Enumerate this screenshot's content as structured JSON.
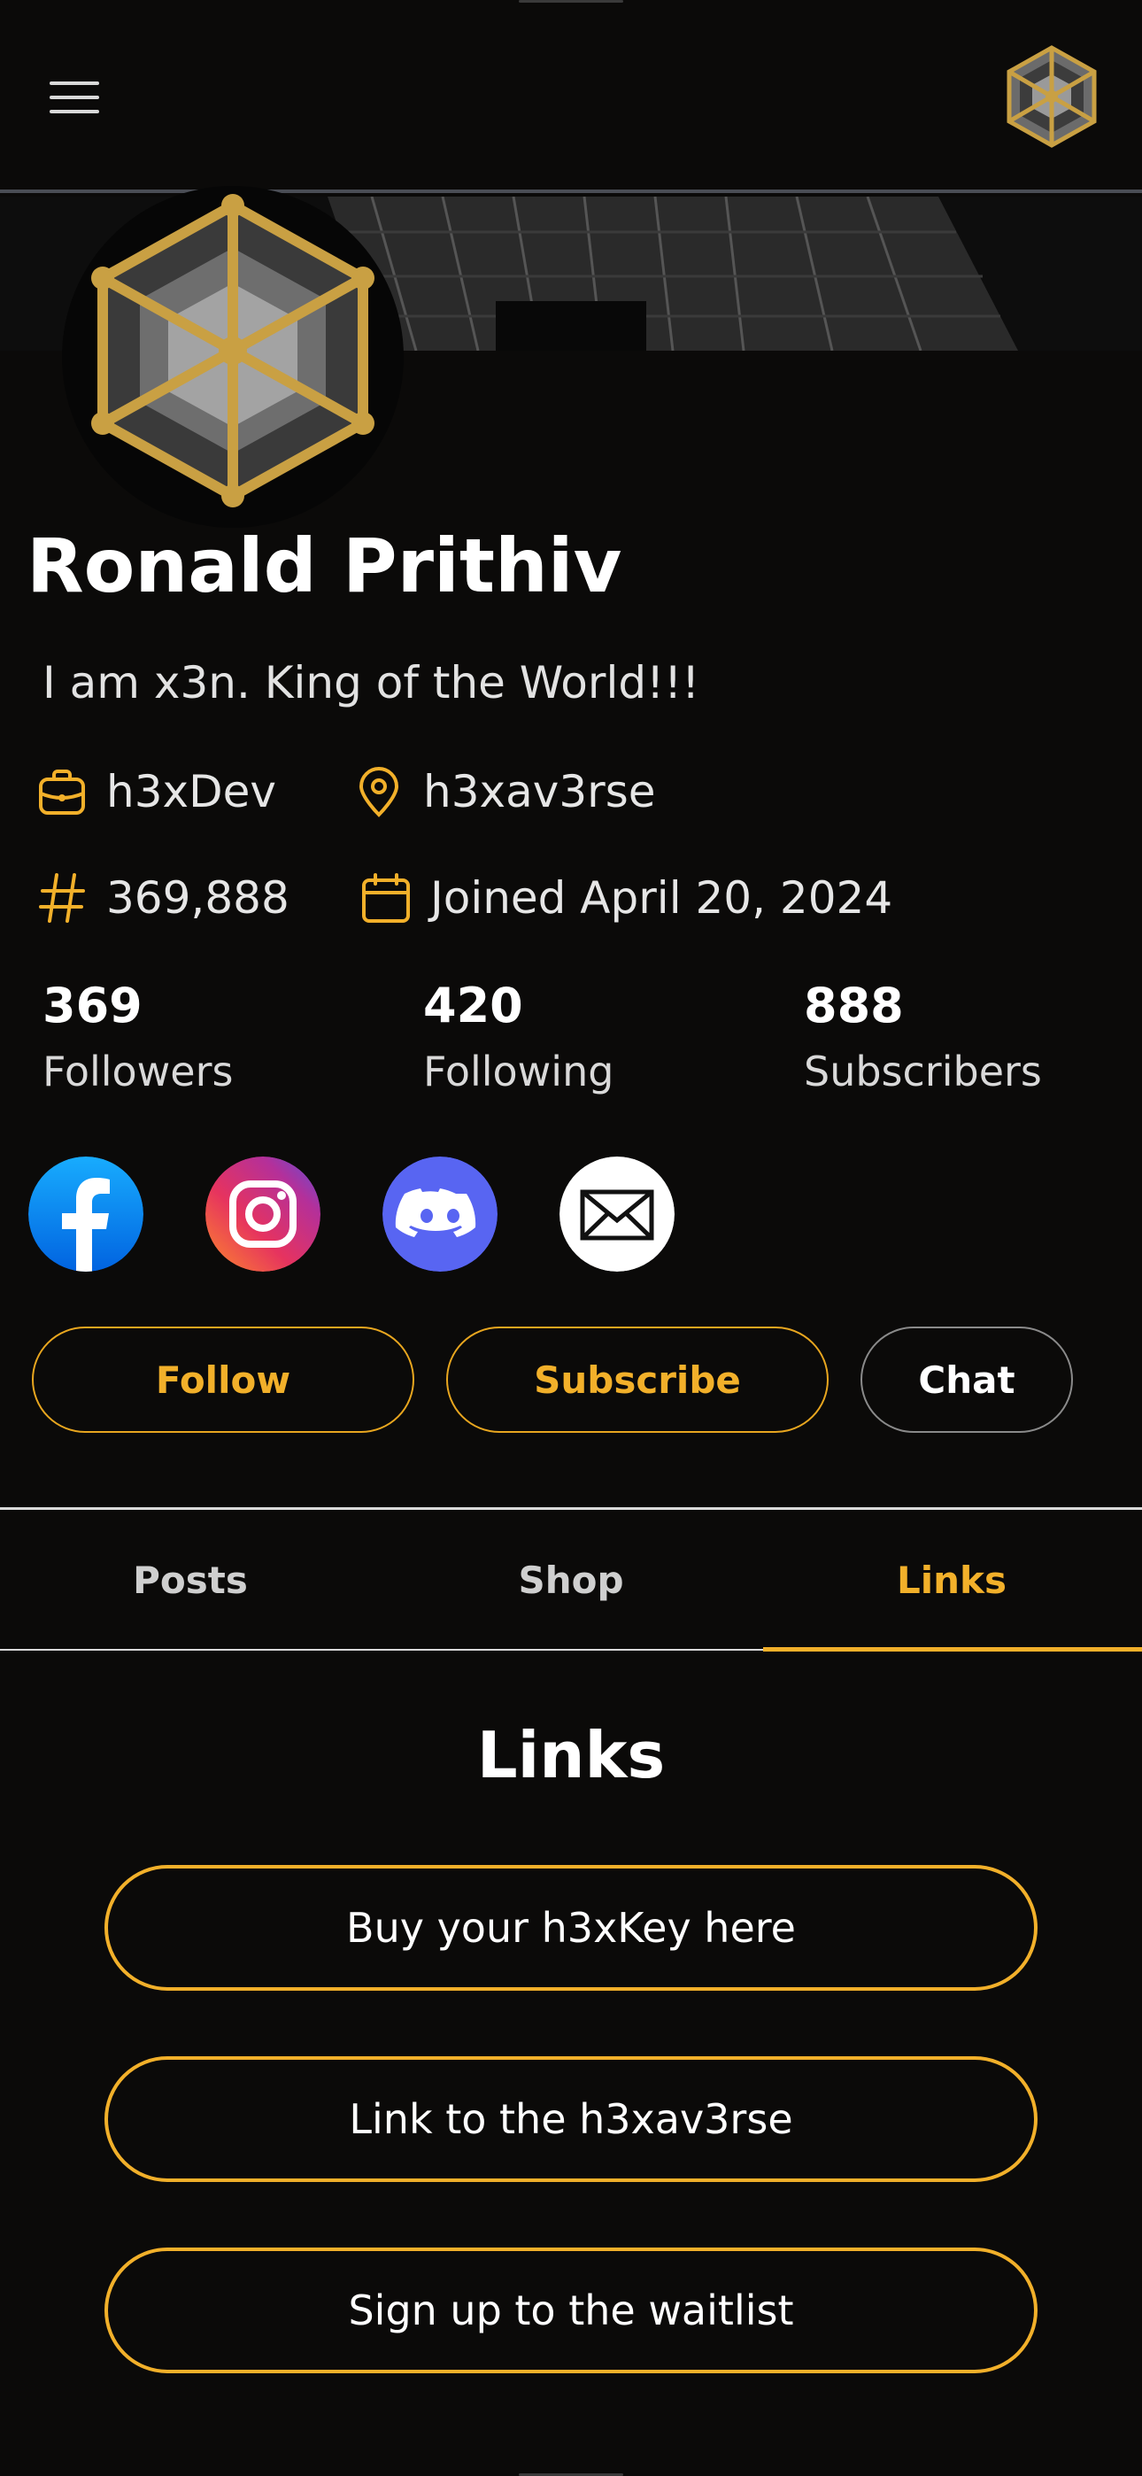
{
  "header": {
    "menu_icon": "hamburger-menu-icon",
    "logo_icon": "hexagon-cube-logo"
  },
  "profile": {
    "name": "Ronald Prithiv",
    "bio": "I am x3n. King of the World!!!",
    "work": "h3xDev",
    "location": "h3xav3rse",
    "tag": "369,888",
    "joined": "Joined April 20, 2024"
  },
  "stats": [
    {
      "value": "369",
      "label": "Followers"
    },
    {
      "value": "420",
      "label": "Following"
    },
    {
      "value": "888",
      "label": "Subscribers"
    }
  ],
  "social": [
    {
      "icon": "facebook-icon"
    },
    {
      "icon": "instagram-icon"
    },
    {
      "icon": "discord-icon"
    },
    {
      "icon": "email-icon"
    }
  ],
  "actions": {
    "follow": "Follow",
    "subscribe": "Subscribe",
    "chat": "Chat"
  },
  "tabs": [
    {
      "label": "Posts",
      "active": false
    },
    {
      "label": "Shop",
      "active": false
    },
    {
      "label": "Links",
      "active": true
    }
  ],
  "links_section": {
    "title": "Links",
    "items": [
      {
        "label": "Buy your h3xKey here"
      },
      {
        "label": "Link to the h3xav3rse"
      },
      {
        "label": "Sign up to the waitlist"
      }
    ]
  },
  "colors": {
    "accent": "#f2b02a",
    "background": "#0b0a09",
    "logo_gold": "#c9a043"
  }
}
